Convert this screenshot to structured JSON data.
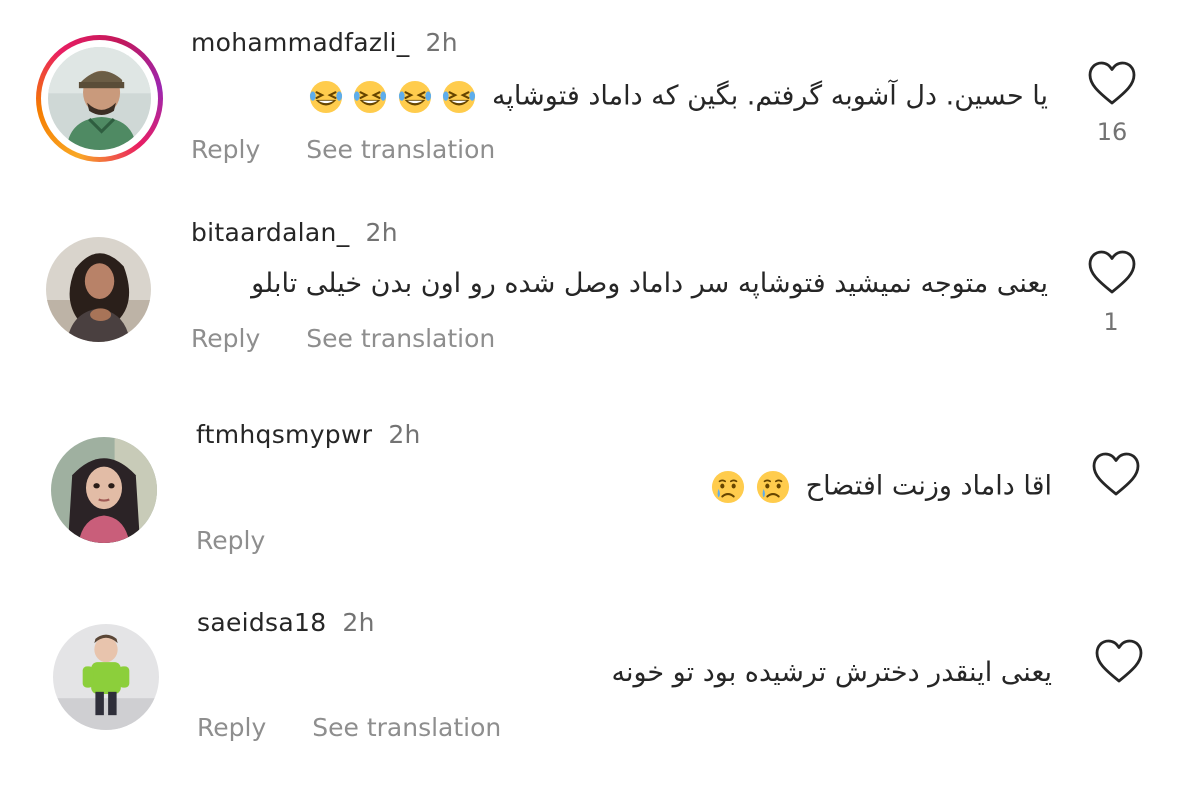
{
  "comments": [
    {
      "username": "mohammadfazli_",
      "time": "2h",
      "text": "یا حسین. دل آشوبه گرفتم. بگین که داماد فتوشاپه",
      "emoji": [
        "grinning-squinting-face",
        "grinning-squinting-face",
        "grinning-squinting-face",
        "grinning-squinting-face"
      ],
      "reply_label": "Reply",
      "translate_label": "See translation",
      "likes": "16",
      "has_story_ring": true
    },
    {
      "username": "bitaardalan_",
      "time": "2h",
      "text": "یعنی متوجه نمیشید فتوشاپه سر داماد وصل شده رو اون بدن خیلی تابلو",
      "emoji": [],
      "reply_label": "Reply",
      "translate_label": "See translation",
      "likes": "1",
      "has_story_ring": false
    },
    {
      "username": "ftmhqsmypwr",
      "time": "2h",
      "text": "اقا داماد وزنت افتضاح",
      "emoji": [
        "crying-face",
        "crying-face"
      ],
      "reply_label": "Reply",
      "translate_label": "",
      "likes": "",
      "has_story_ring": false
    },
    {
      "username": "saeidsa18",
      "time": "2h",
      "text": "یعنی اینقدر دخترش ترشیده بود تو خونه",
      "emoji": [],
      "reply_label": "Reply",
      "translate_label": "See translation",
      "likes": "",
      "has_story_ring": false
    }
  ],
  "icons": {
    "like": "heart-outline-icon"
  },
  "colors": {
    "text": "#262626",
    "secondary": "#8e8e8e",
    "story_ring_start": "#f9a825",
    "story_ring_end": "#c2185b"
  }
}
